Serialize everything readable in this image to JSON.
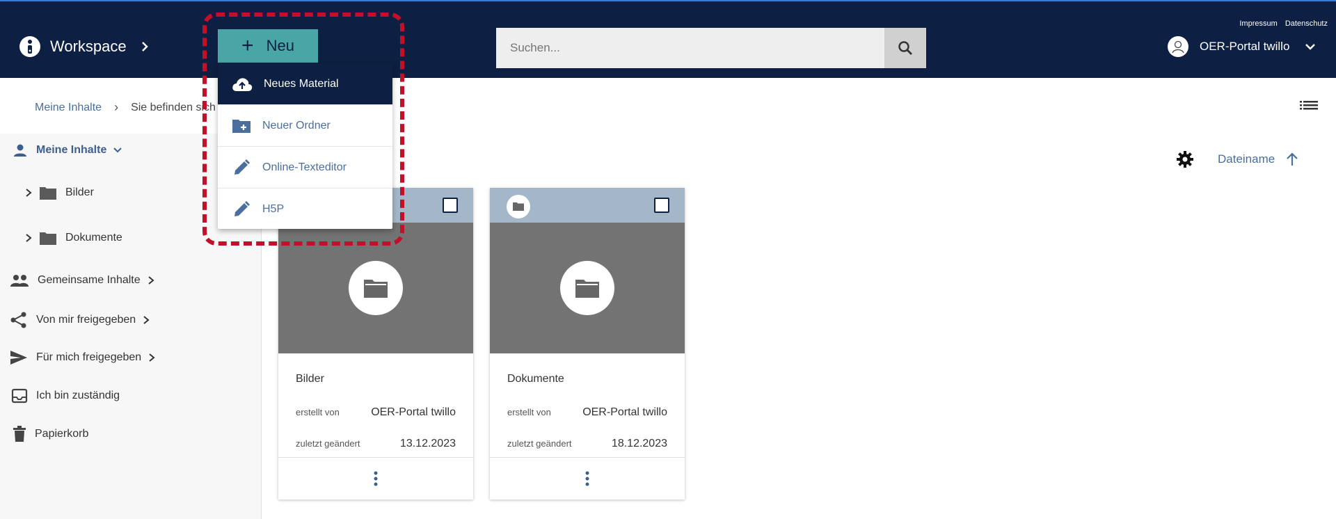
{
  "header": {
    "title": "Workspace",
    "new_label": "Neu",
    "search_placeholder": "Suchen...",
    "links": [
      "Impressum",
      "Datenschutz"
    ],
    "user_name": "OER-Portal twillo"
  },
  "breadcrumb": {
    "root": "Meine Inhalte",
    "current": "Sie befinden sich"
  },
  "sidebar": {
    "root_label": "Meine Inhalte",
    "folders": [
      {
        "label": "Bilder"
      },
      {
        "label": "Dokumente"
      }
    ],
    "items": [
      {
        "label": "Gemeinsame Inhalte",
        "icon": "people-icon"
      },
      {
        "label": "Von mir freigegeben",
        "icon": "share-icon"
      },
      {
        "label": "Für mich freigegeben",
        "icon": "send-icon"
      },
      {
        "label": "Ich bin zuständig",
        "icon": "inbox-icon"
      },
      {
        "label": "Papierkorb",
        "icon": "trash-icon"
      }
    ]
  },
  "sort": {
    "label": "Dateiname"
  },
  "new_menu": {
    "items": [
      {
        "label": "Neues Material",
        "icon": "cloud-upload-icon"
      },
      {
        "label": "Neuer Ordner",
        "icon": "create-folder-icon"
      },
      {
        "label": "Online-Texteditor",
        "icon": "pencil-icon"
      },
      {
        "label": "H5P",
        "icon": "pencil-icon"
      }
    ]
  },
  "cards": [
    {
      "title": "Bilder",
      "created_by_label": "erstellt von",
      "created_by": "OER-Portal twillo",
      "modified_label": "zuletzt geändert",
      "modified": "13.12.2023"
    },
    {
      "title": "Dokumente",
      "created_by_label": "erstellt von",
      "created_by": "OER-Portal twillo",
      "modified_label": "zuletzt geändert",
      "modified": "18.12.2023"
    }
  ],
  "colors": {
    "header_bg": "#0d1f42",
    "accent": "#4aa6a6",
    "link": "#4a6f9c",
    "highlight": "#c2102b"
  }
}
